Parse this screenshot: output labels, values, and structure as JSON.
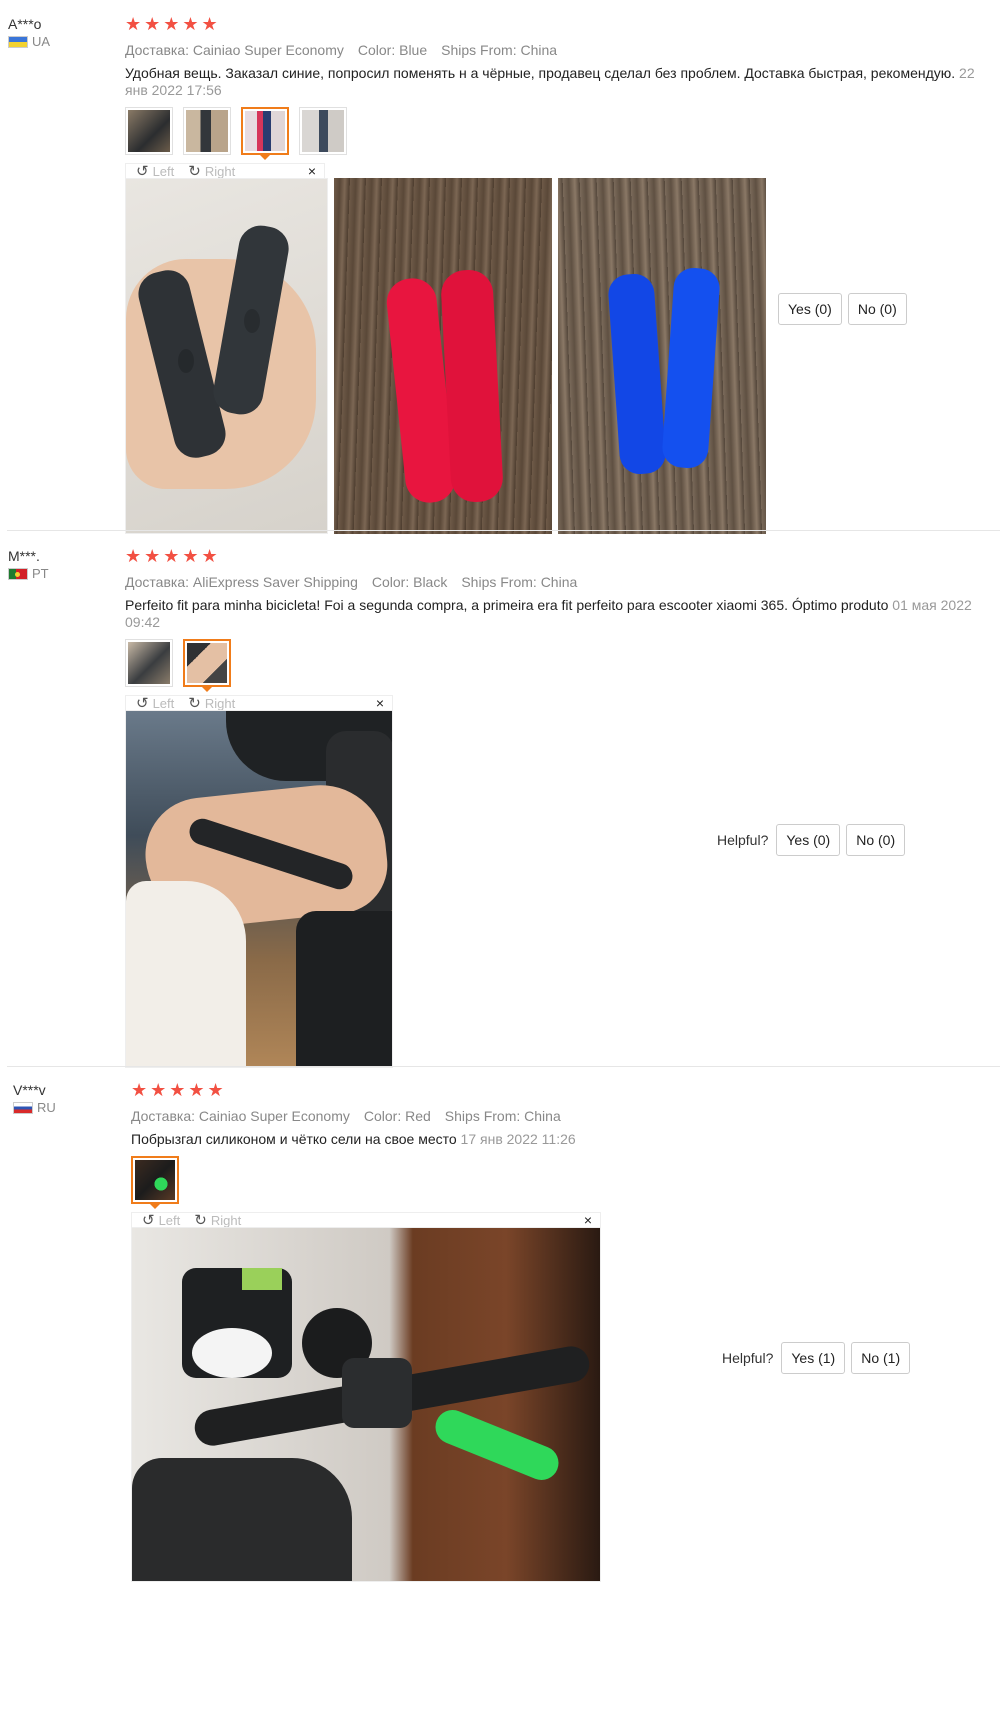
{
  "reviews": [
    {
      "username": "A***o",
      "country": "UA",
      "stars": "★★★★★",
      "shipping": "Доставка: Cainiao Super Economy",
      "color": "Color: Blue",
      "ships_from": "Ships From: China",
      "text": "Удобная вещь. Заказал синие, попросил поменять н а чёрные, продавец сделал без проблем. Доставка быстрая, рекомендую.",
      "date": "22 янв 2022 17:56",
      "helpful_label": "",
      "yes_label": "Yes (0)",
      "no_label": "No (0)"
    },
    {
      "username": "M***.",
      "country": "PT",
      "stars": "★★★★★",
      "shipping": "Доставка: AliExpress Saver Shipping",
      "color": "Color: Black",
      "ships_from": "Ships From: China",
      "text": "Perfeito fit para minha bicicleta! Foi a segunda compra, a primeira era fit perfeito para escooter xiaomi 365. Óptimo produto",
      "date": "01 мая 2022 09:42",
      "helpful_label": "Helpful?",
      "yes_label": "Yes (0)",
      "no_label": "No (0)"
    },
    {
      "username": "V***v",
      "country": "RU",
      "stars": "★★★★★",
      "shipping": "Доставка: Cainiao Super Economy",
      "color": "Color: Red",
      "ships_from": "Ships From: China",
      "text": "Побрызгал силиконом и чётко сели на свое место",
      "date": "17 янв 2022 11:26",
      "helpful_label": "Helpful?",
      "yes_label": "Yes (1)",
      "no_label": "No (1)"
    }
  ],
  "viewer": {
    "rotate_left": "Left",
    "rotate_right": "Right",
    "close": "×"
  },
  "icons": {
    "rotate_left": "rotate-left-icon",
    "rotate_right": "rotate-right-icon",
    "close": "close-icon",
    "star": "star-icon"
  },
  "colors": {
    "star": "#f25042",
    "active_thumb": "#f07c1a",
    "grip_black": "#2e3236",
    "grip_red": "#e8153f",
    "grip_blue": "#1247e6",
    "grip_green": "#2fd85a"
  }
}
